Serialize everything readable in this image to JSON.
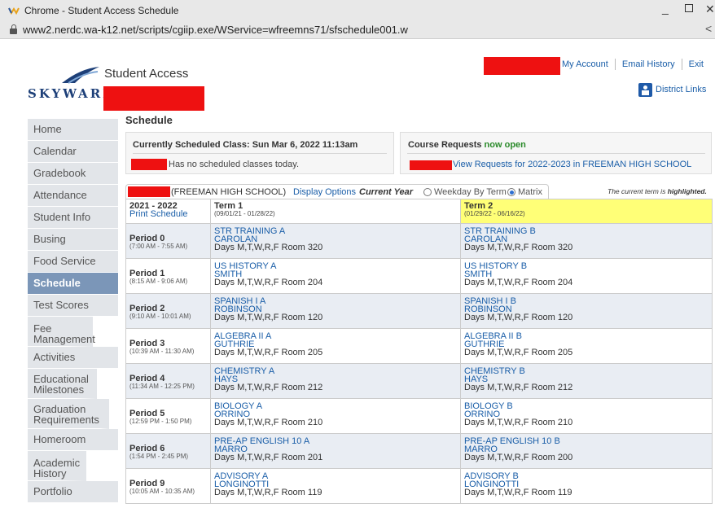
{
  "browser": {
    "window_title": "Chrome - Student Access Schedule",
    "url": "www2.nerdc.wa-k12.net/scripts/cgiip.exe/WService=wfreemns71/sfschedule001.w",
    "minimize": "_",
    "close": "✕",
    "share": "<"
  },
  "header": {
    "logo": "SKYWARD",
    "app_name": "Student Access",
    "links": [
      "My Account",
      "Email History",
      "Exit"
    ],
    "district_links": "District Links"
  },
  "sidebar": {
    "items": [
      {
        "label": "Home"
      },
      {
        "label": "Calendar"
      },
      {
        "label": "Gradebook"
      },
      {
        "label": "Attendance"
      },
      {
        "label": "Student Info"
      },
      {
        "label": "Busing"
      },
      {
        "label": "Food Service"
      },
      {
        "label": "Schedule",
        "active": true
      },
      {
        "label": "Test Scores"
      },
      {
        "label": "Fee Management"
      },
      {
        "label": "Activities"
      },
      {
        "label": "Educational Milestones"
      },
      {
        "label": "Graduation Requirements"
      },
      {
        "label": "Homeroom"
      },
      {
        "label": "Academic History"
      },
      {
        "label": "Portfolio"
      }
    ]
  },
  "main": {
    "title": "Schedule",
    "current_class": {
      "title": "Currently Scheduled Class: Sun Mar 6, 2022 11:13am",
      "message": "Has no scheduled classes today."
    },
    "course_requests": {
      "title": "Course Requests",
      "status": "now open",
      "link": "View Requests for 2022-2023 in FREEMAN HIGH SCHOOL"
    },
    "options": {
      "school": "(FREEMAN HIGH SCHOOL)",
      "display_options": "Display Options",
      "current_year": "Current Year",
      "weekday_by_term": "Weekday By Term",
      "matrix": "Matrix",
      "selected": "Matrix",
      "note_prefix": "The current term is ",
      "note_bold": "highlighted."
    },
    "table": {
      "year": "2021 - 2022",
      "print": "Print Schedule",
      "terms": [
        {
          "name": "Term 1",
          "dates": "(09/01/21 - 01/28/22)",
          "current": false
        },
        {
          "name": "Term 2",
          "dates": "(01/29/22 - 06/16/22)",
          "current": true
        }
      ],
      "periods": [
        {
          "name": "Period 0",
          "time": "(7:00 AM - 7:55 AM)",
          "classes": [
            {
              "course": "STR TRAINING A",
              "teacher": "CAROLAN",
              "days": "Days M,T,W,R,F  Room 320"
            },
            {
              "course": "STR TRAINING B",
              "teacher": "CAROLAN",
              "days": "Days M,T,W,R,F  Room 320"
            }
          ]
        },
        {
          "name": "Period 1",
          "time": "(8:15 AM - 9:06 AM)",
          "classes": [
            {
              "course": "US HISTORY A",
              "teacher": "SMITH",
              "days": "Days M,T,W,R,F  Room 204"
            },
            {
              "course": "US HISTORY B",
              "teacher": "SMITH",
              "days": "Days M,T,W,R,F  Room 204"
            }
          ]
        },
        {
          "name": "Period 2",
          "time": "(9:10 AM - 10:01 AM)",
          "classes": [
            {
              "course": "SPANISH I A",
              "teacher": "ROBINSON",
              "days": "Days M,T,W,R,F  Room 120"
            },
            {
              "course": "SPANISH I B",
              "teacher": "ROBINSON",
              "days": "Days M,T,W,R,F  Room 120"
            }
          ]
        },
        {
          "name": "Period 3",
          "time": "(10:39 AM - 11:30 AM)",
          "classes": [
            {
              "course": "ALGEBRA II A",
              "teacher": "GUTHRIE",
              "days": "Days M,T,W,R,F  Room 205"
            },
            {
              "course": "ALGEBRA II B",
              "teacher": "GUTHRIE",
              "days": "Days M,T,W,R,F  Room 205"
            }
          ]
        },
        {
          "name": "Period 4",
          "time": "(11:34 AM - 12:25 PM)",
          "classes": [
            {
              "course": "CHEMISTRY A",
              "teacher": "HAYS",
              "days": "Days M,T,W,R,F  Room 212"
            },
            {
              "course": "CHEMISTRY B",
              "teacher": "HAYS",
              "days": "Days M,T,W,R,F  Room 212"
            }
          ]
        },
        {
          "name": "Period 5",
          "time": "(12:59 PM - 1:50 PM)",
          "classes": [
            {
              "course": "BIOLOGY A",
              "teacher": "ORRINO",
              "days": "Days M,T,W,R,F  Room 210"
            },
            {
              "course": "BIOLOGY B",
              "teacher": "ORRINO",
              "days": "Days M,T,W,R,F  Room 210"
            }
          ]
        },
        {
          "name": "Period 6",
          "time": "(1:54 PM - 2:45 PM)",
          "classes": [
            {
              "course": "PRE-AP ENGLISH 10 A",
              "teacher": "MARRO",
              "days": "Days M,T,W,R,F  Room 201"
            },
            {
              "course": "PRE-AP ENGLISH 10 B",
              "teacher": "MARRO",
              "days": "Days M,T,W,R,F  Room 200"
            }
          ]
        },
        {
          "name": "Period 9",
          "time": "(10:05 AM - 10:35 AM)",
          "classes": [
            {
              "course": "ADVISORY A",
              "teacher": "LONGINOTTI",
              "days": "Days M,T,W,R,F  Room 119"
            },
            {
              "course": "ADVISORY B",
              "teacher": "LONGINOTTI",
              "days": "Days M,T,W,R,F  Room 119"
            }
          ]
        }
      ]
    }
  },
  "colors": {
    "redaction": "#ee1111",
    "link": "#1a5ea8",
    "current_term_highlight": "#ffff77",
    "active_nav": "#7b96b8"
  }
}
